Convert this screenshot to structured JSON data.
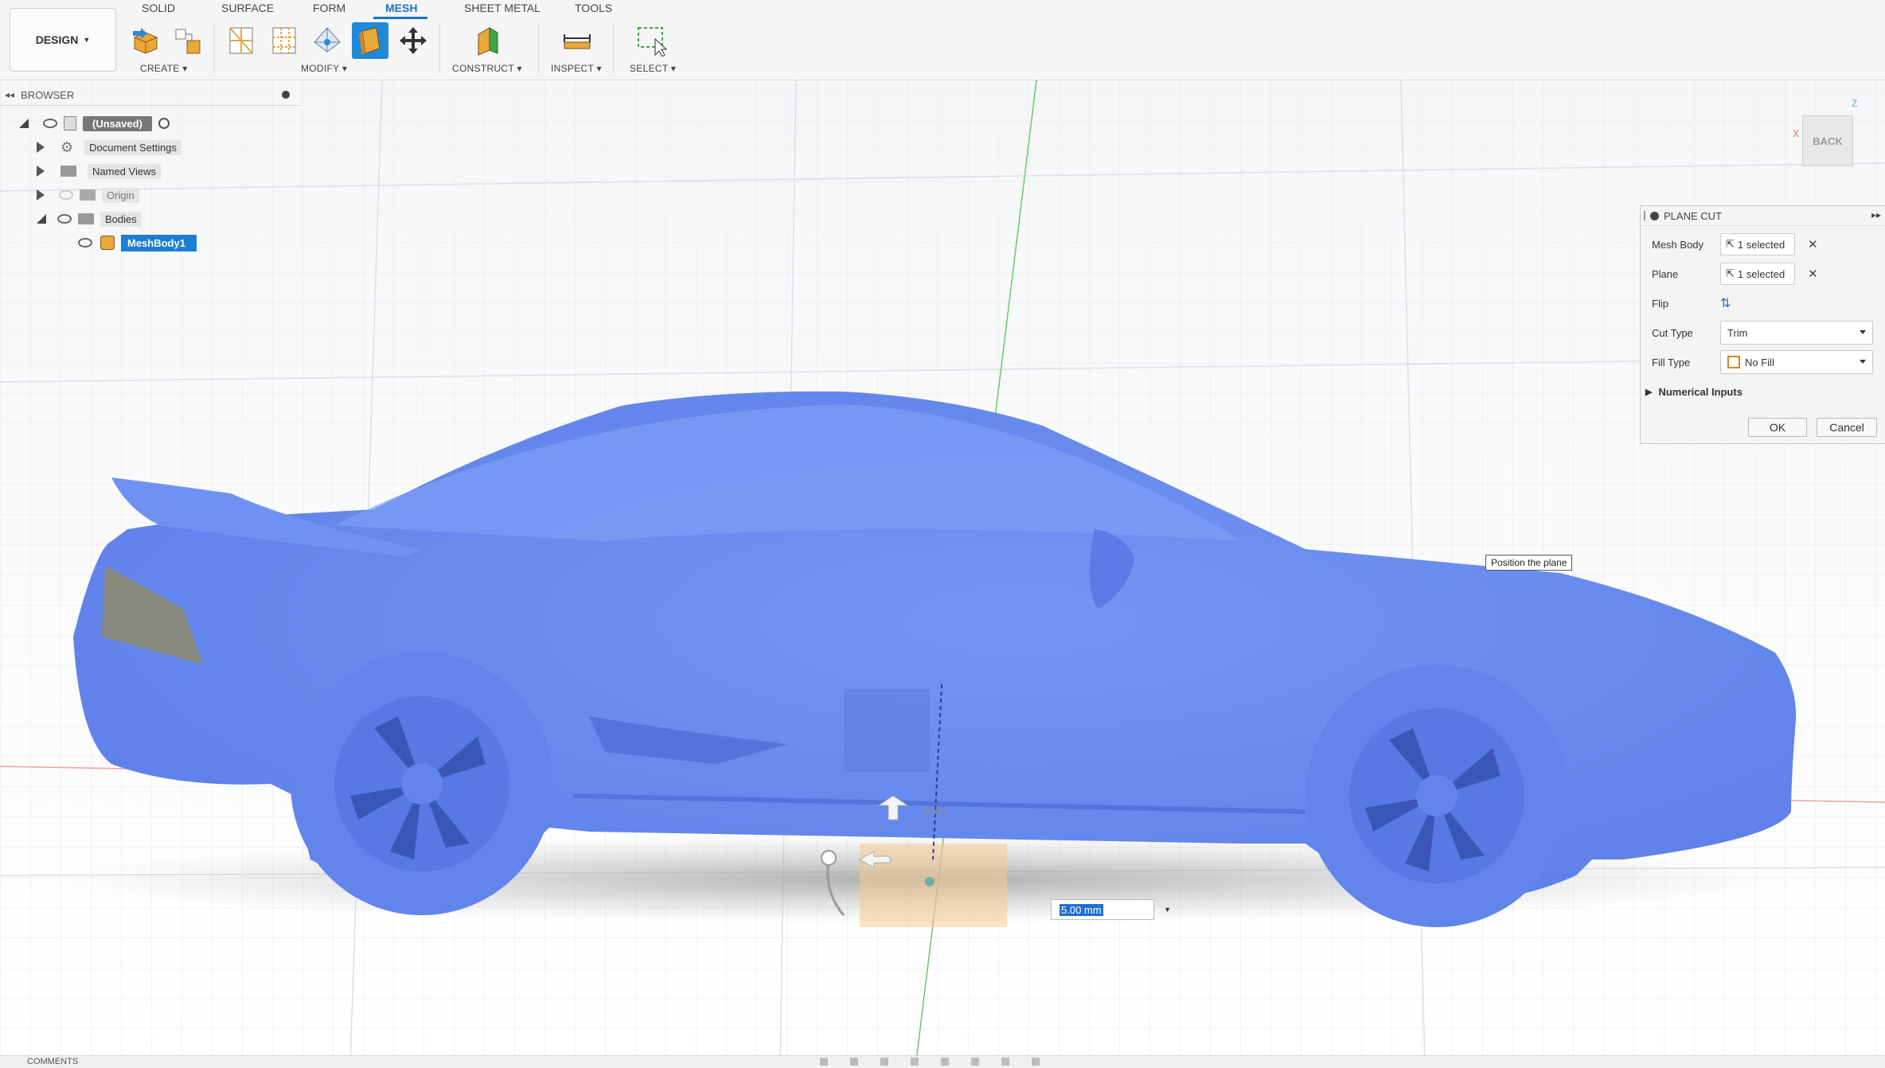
{
  "toolbar": {
    "workspace_label": "DESIGN",
    "tabs": [
      "SOLID",
      "SURFACE",
      "FORM",
      "MESH",
      "SHEET METAL",
      "TOOLS"
    ],
    "active_tab": "MESH",
    "groups": [
      "CREATE",
      "MODIFY",
      "CONSTRUCT",
      "INSPECT",
      "SELECT"
    ]
  },
  "browser": {
    "title": "BROWSER",
    "items": [
      {
        "label": "(Unsaved)"
      },
      {
        "label": "Document Settings"
      },
      {
        "label": "Named Views"
      },
      {
        "label": "Origin"
      },
      {
        "label": "Bodies"
      },
      {
        "label": "MeshBody1"
      }
    ]
  },
  "viewcube": {
    "face_label": "BACK",
    "axis_z": "Z",
    "axis_x": "X"
  },
  "dialog": {
    "title": "PLANE CUT",
    "rows": [
      {
        "label": "Mesh Body",
        "value": "1 selected"
      },
      {
        "label": "Plane",
        "value": "1 selected"
      },
      {
        "label": "Flip"
      },
      {
        "label": "Cut Type",
        "value": "Trim"
      },
      {
        "label": "Fill Type",
        "value": "No Fill"
      }
    ],
    "numerical_inputs": "Numerical Inputs",
    "ok": "OK",
    "cancel": "Cancel"
  },
  "tooltip": "Position the plane",
  "dimension": {
    "value": "5.00 mm"
  },
  "manipulator_readout": "5.00",
  "bottom": {
    "comments_label": "COMMENTS"
  },
  "colors": {
    "accent": "#1a73c7",
    "mesh": "#6b8cf0",
    "mesh_dark": "#5474db"
  }
}
